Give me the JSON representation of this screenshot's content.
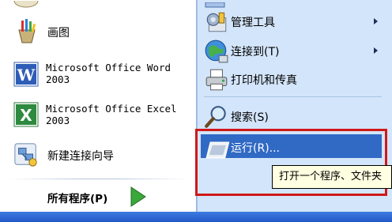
{
  "left_items": {
    "paint": "画图",
    "word_line1": "Microsoft Office Word",
    "word_line2": "2003",
    "excel_line1": "Microsoft Office Excel",
    "excel_line2": "2003",
    "new_connection": "新建连接向导",
    "all_programs": "所有程序(P)"
  },
  "right_items": {
    "admin_tools": "管理工具",
    "connect_to": "连接到(T)",
    "printers": "打印机和传真",
    "search": "搜索(S)",
    "run": "运行(R)..."
  },
  "tooltip": "打开一个程序、文件夹",
  "colors": {
    "right_pane": "#d3e5fa",
    "highlight": "#316ac5",
    "callout": "#d01818"
  }
}
